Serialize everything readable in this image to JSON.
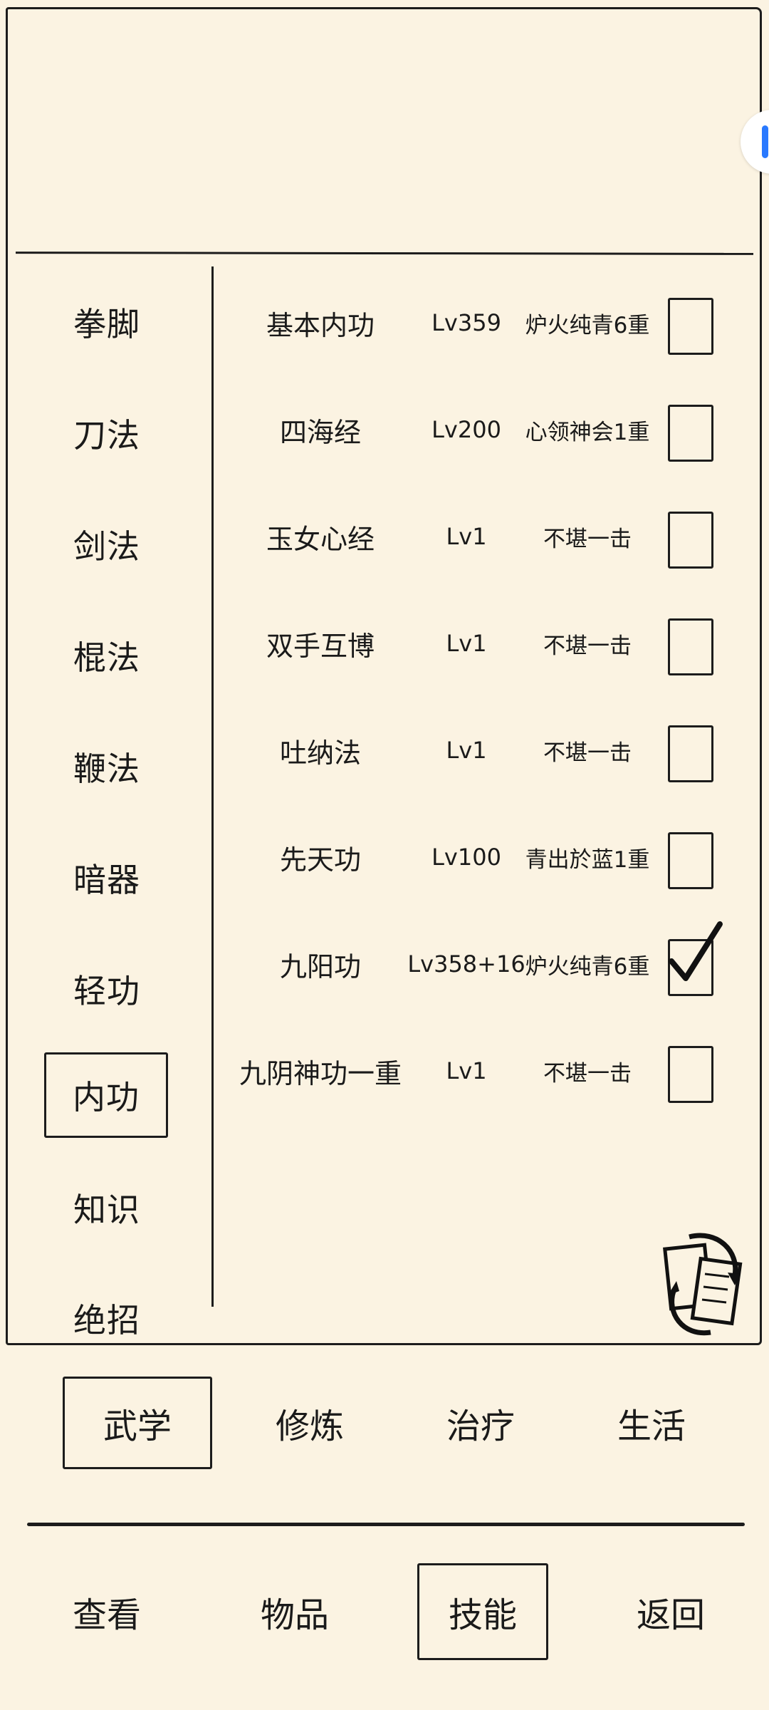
{
  "sidebar": {
    "items": [
      {
        "label": "拳脚"
      },
      {
        "label": "刀法"
      },
      {
        "label": "剑法"
      },
      {
        "label": "棍法"
      },
      {
        "label": "鞭法"
      },
      {
        "label": "暗器"
      },
      {
        "label": "轻功"
      },
      {
        "label": "内功",
        "active": true
      },
      {
        "label": "知识"
      },
      {
        "label": "绝招"
      }
    ]
  },
  "skills": [
    {
      "name": "基本内功",
      "level": "Lv359",
      "rank": "炉火纯青6重",
      "checked": false
    },
    {
      "name": "四海经",
      "level": "Lv200",
      "rank": "心领神会1重",
      "checked": false
    },
    {
      "name": "玉女心经",
      "level": "Lv1",
      "rank": "不堪一击",
      "checked": false
    },
    {
      "name": "双手互博",
      "level": "Lv1",
      "rank": "不堪一击",
      "checked": false
    },
    {
      "name": "吐纳法",
      "level": "Lv1",
      "rank": "不堪一击",
      "checked": false
    },
    {
      "name": "先天功",
      "level": "Lv100",
      "rank": "青出於蓝1重",
      "checked": false
    },
    {
      "name": "九阳功",
      "level": "Lv358+16",
      "rank": "炉火纯青6重",
      "checked": true
    },
    {
      "name": "九阴神功一重",
      "level": "Lv1",
      "rank": "不堪一击",
      "checked": false
    }
  ],
  "tabs": [
    {
      "label": "武学",
      "active": true
    },
    {
      "label": "修炼"
    },
    {
      "label": "治疗"
    },
    {
      "label": "生活"
    }
  ],
  "nav": [
    {
      "label": "查看"
    },
    {
      "label": "物品"
    },
    {
      "label": "技能",
      "active": true
    },
    {
      "label": "返回"
    }
  ],
  "icons": {
    "swap": "swap-pages-icon",
    "check": "checkmark-icon",
    "floating": "floating-toolbar-icon"
  },
  "colors": {
    "background": "#fbf3e2",
    "ink": "#1c1c1c",
    "floating_accent": "#2979ff"
  }
}
